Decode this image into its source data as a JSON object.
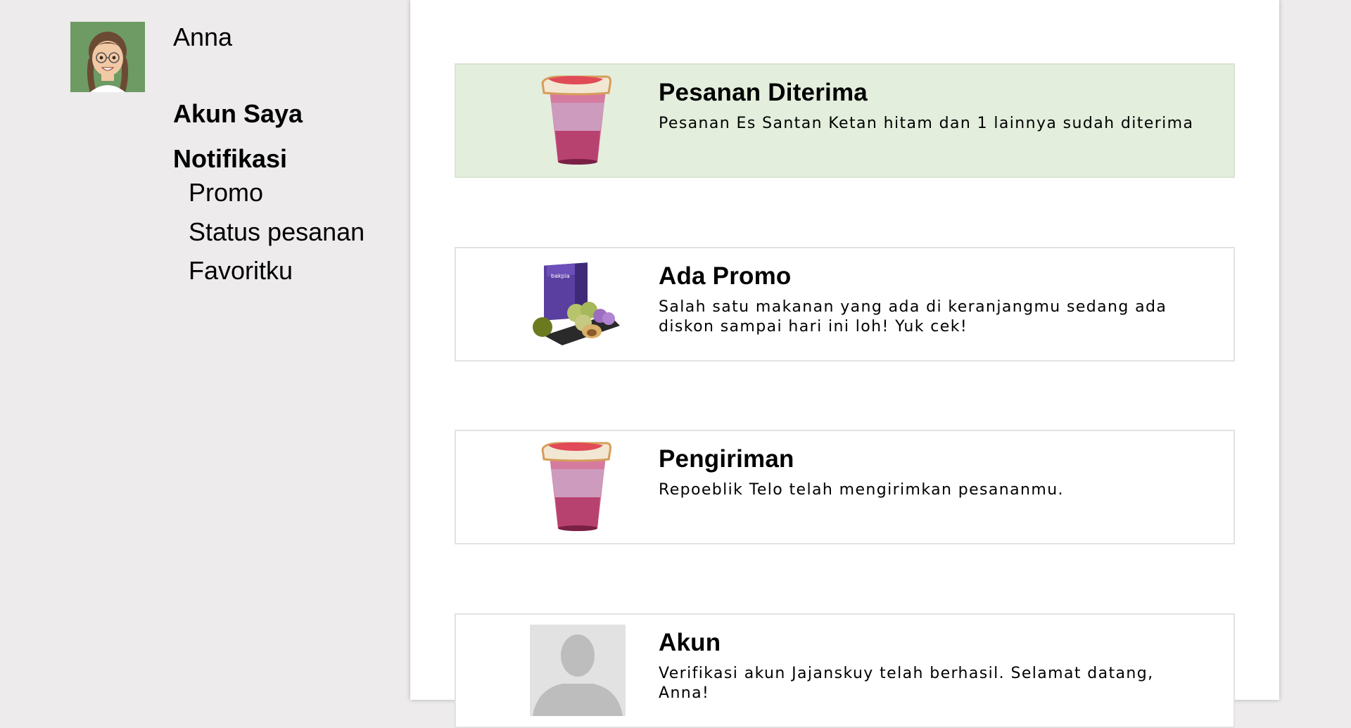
{
  "sidebar": {
    "username": "Anna",
    "avatar_bg": "#6e9a64",
    "nav": {
      "akun_saya": "Akun Saya",
      "notifikasi": "Notifikasi",
      "sub": [
        "Promo",
        "Status pesanan",
        "Favoritku"
      ]
    }
  },
  "notifications": [
    {
      "title": "Pesanan Diterima",
      "text": "Pesanan Es Santan Ketan hitam dan 1 lainnya sudah diterima",
      "icon": "drink-cup-image",
      "highlighted": true,
      "highlight_color": "#e3eedd"
    },
    {
      "title": "Ada Promo",
      "text": "Salah satu makanan yang ada di keranjangmu sedang ada diskon sampai hari ini loh! Yuk cek!",
      "icon": "bakpia-box-image",
      "box_brand": "bakpia"
    },
    {
      "title": "Pengiriman",
      "text": "Repoeblik Telo telah mengirimkan pesananmu.",
      "icon": "drink-cup-image"
    },
    {
      "title": "Akun",
      "text": "Verifikasi akun Jajanskuy telah berhasil. Selamat datang, Anna!",
      "icon": "user-placeholder-image"
    }
  ]
}
